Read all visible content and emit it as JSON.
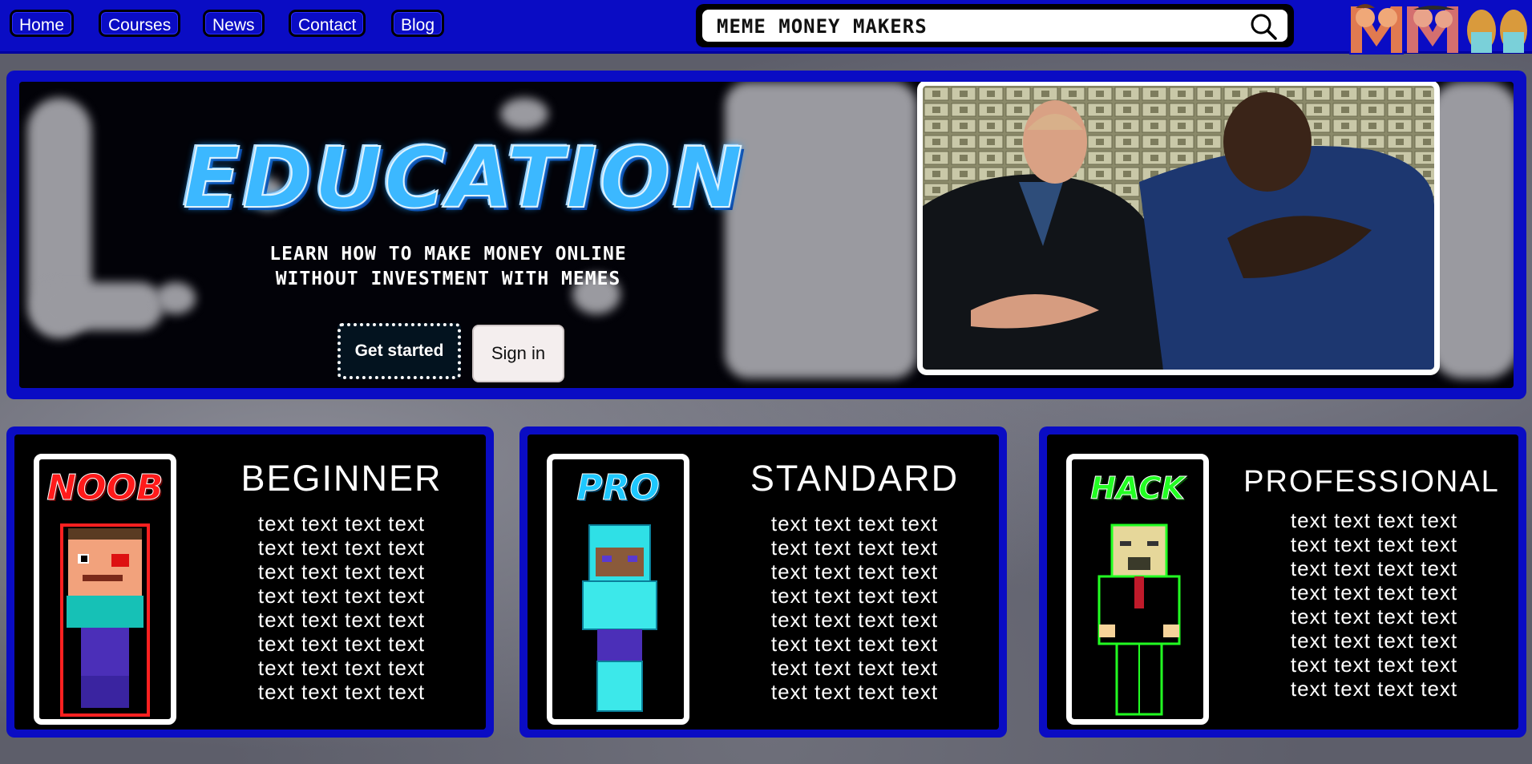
{
  "nav": {
    "links": [
      "Home",
      "Courses",
      "News",
      "Contact",
      "Blog"
    ]
  },
  "search": {
    "value": "MEME MONEY MAKERS"
  },
  "logo": {
    "text": "MM"
  },
  "hero": {
    "title": "EDUCATION",
    "tagline_line1": "LEARN HOW TO MAKE MONEY ONLINE",
    "tagline_line2": "WITHOUT INVESTMENT WITH MEMES",
    "get_started": "Get started",
    "sign_in": "Sign in"
  },
  "cards": [
    {
      "badge": "NOOB",
      "badge_color": "#ff1a1a",
      "title": "BEGINNER",
      "lines": [
        "text text text text",
        "text text text text",
        "text text text text",
        "text text text text",
        "text text text text",
        "text text text text",
        "text text text text",
        "text text text text"
      ]
    },
    {
      "badge": "PRO",
      "badge_color": "#1ec8ff",
      "title": "STANDARD",
      "lines": [
        "text text text text",
        "text text text text",
        "text text text text",
        "text text text text",
        "text text text text",
        "text text text text",
        "text text text text",
        "text text text text"
      ]
    },
    {
      "badge": "HACK",
      "badge_color": "#22ff22",
      "title": "PROFESSIONAL",
      "lines": [
        "text text text text",
        "text text text text",
        "text text text text",
        "text text text text",
        "text text text text",
        "text text text text",
        "text text text text",
        "text text text text"
      ]
    }
  ],
  "colors": {
    "nav_blue": "#0a0cc4",
    "panel_black": "#000000",
    "title_cyan": "#3cb8ff"
  }
}
